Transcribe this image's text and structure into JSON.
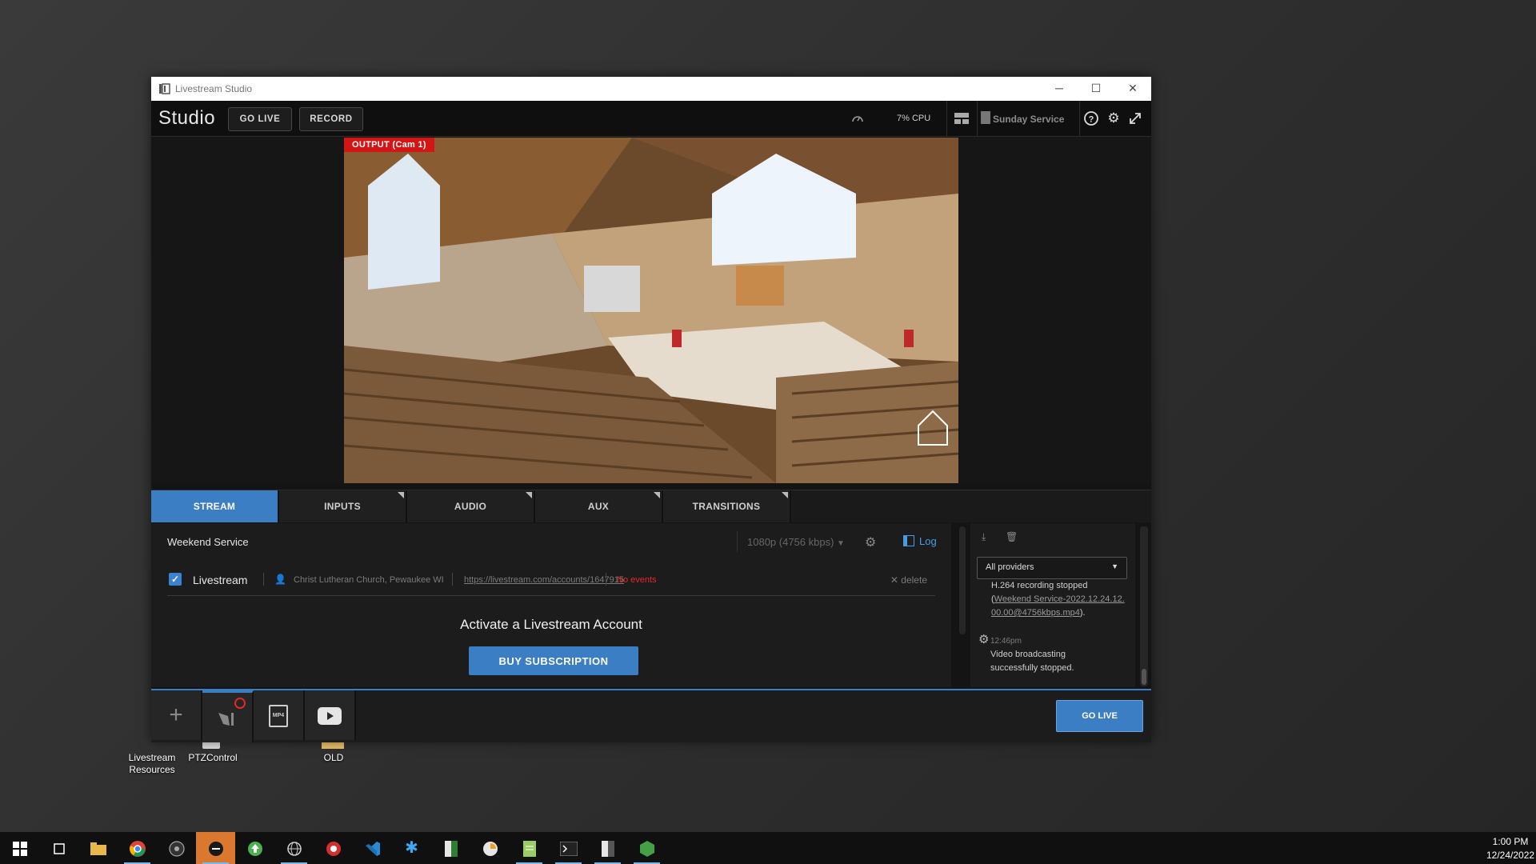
{
  "window": {
    "title": "Livestream Studio",
    "minimize": "─",
    "maximize": "☐",
    "close": "✕"
  },
  "toolbar": {
    "brand": "Studio",
    "go_live": "GO LIVE",
    "record": "RECORD",
    "cpu": "7% CPU",
    "project": "Sunday Service"
  },
  "preview": {
    "output_label": "OUTPUT (Cam 1)"
  },
  "tabs": [
    {
      "label": "STREAM",
      "active": true
    },
    {
      "label": "INPUTS"
    },
    {
      "label": "AUDIO"
    },
    {
      "label": "AUX"
    },
    {
      "label": "TRANSITIONS"
    }
  ],
  "stream": {
    "title": "Weekend Service",
    "quality": "1080p (4756 kbps)",
    "log_label": "Log",
    "provider": {
      "name": "Livestream",
      "account": "Christ Lutheran Church, Pewaukee WI",
      "url": "https://livestream.com/accounts/1647915",
      "events": "No events",
      "delete": "delete"
    },
    "activate": "Activate a Livestream Account",
    "buy": "BUY SUBSCRIPTION"
  },
  "log": {
    "filter": "All providers",
    "entries": [
      {
        "text": "H.264 recording stopped",
        "link_open": "(",
        "link": "Weekend Service-2022.12.24.12.00.00@4756kbps.mp4",
        "link_close": ")."
      },
      {
        "time": "12:46pm",
        "text": "Video broadcasting successfully stopped."
      }
    ]
  },
  "bottom": {
    "go_live": "GO LIVE",
    "mp4_label": "MP4"
  },
  "desktop": {
    "icons": [
      {
        "label": "Livestream Resources"
      },
      {
        "label": "PTZControl"
      },
      {
        "label": "OLD"
      }
    ]
  },
  "taskbar": {
    "time": "1:00 PM",
    "date": "12/24/2022"
  },
  "colors": {
    "accent": "#3c7ec4",
    "live_red": "#d31515",
    "no_events": "#e02a2a"
  }
}
